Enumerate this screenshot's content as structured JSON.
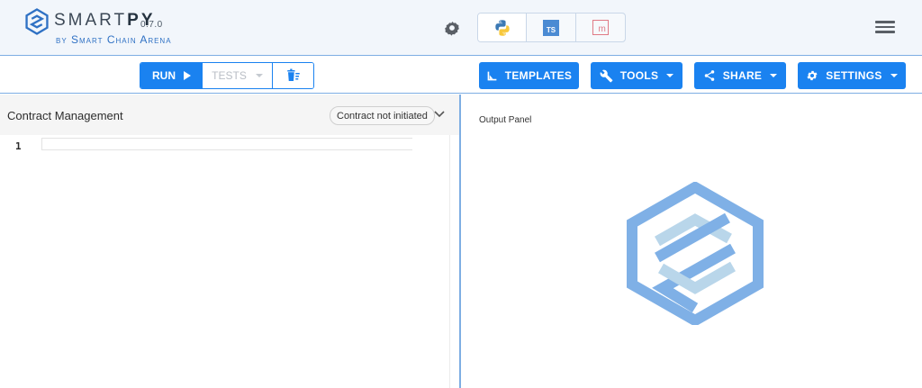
{
  "header": {
    "brand_light": "SMART",
    "brand_bold": "PY",
    "version": "0.7.0",
    "byline": "by Smart Chain Arena",
    "languages": [
      {
        "name": "python",
        "label": "",
        "active": true
      },
      {
        "name": "typescript",
        "label": "TS",
        "active": false
      },
      {
        "name": "michelson",
        "label": "m",
        "active": false
      }
    ]
  },
  "toolbar": {
    "run_label": "RUN",
    "tests_label": "TESTS",
    "templates_label": "TEMPLATES",
    "tools_label": "TOOLS",
    "share_label": "SHARE",
    "settings_label": "SETTINGS"
  },
  "editor_panel": {
    "title": "Contract Management",
    "status": "Contract not initiated",
    "line_numbers": [
      "1"
    ]
  },
  "output_panel": {
    "label": "Output Panel"
  },
  "colors": {
    "accent": "#1a82f0",
    "header_bg": "#f2f6fb",
    "divider": "#7eaee3",
    "logo_dark": "#7fb0e6",
    "logo_light": "#b9d6ea"
  },
  "icons": [
    "smartpy-logo-icon",
    "theme-gear-icon",
    "python-icon",
    "typescript-icon",
    "michelson-icon",
    "hamburger-menu-icon",
    "play-icon",
    "clear-output-icon",
    "templates-icon",
    "wrench-icon",
    "share-icon",
    "settings-gear-icon",
    "chevron-down-icon"
  ]
}
